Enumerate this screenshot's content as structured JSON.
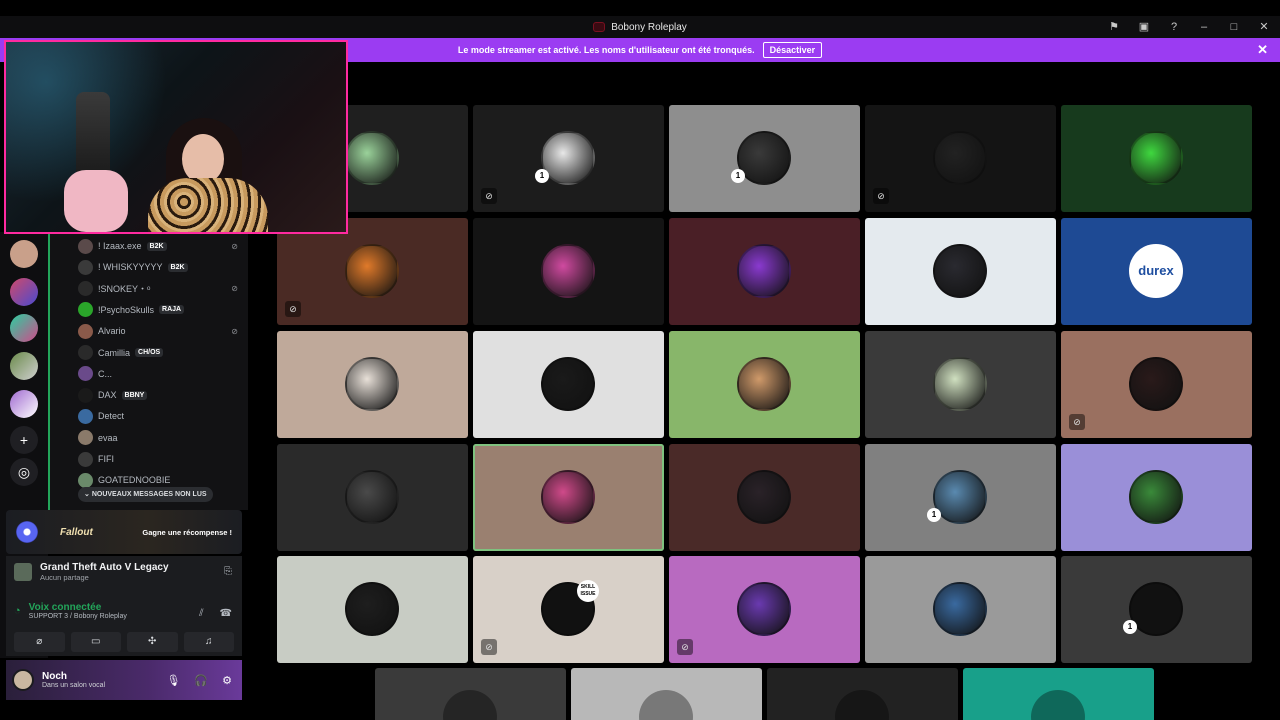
{
  "titlebar": {
    "title": "Bobony Roleplay",
    "icons": [
      "flag-icon",
      "inbox-icon",
      "help-icon",
      "minimize-icon",
      "maximize-icon",
      "close-icon"
    ]
  },
  "banner": {
    "text": "Le mode streamer est activé. Les noms d'utilisateur ont été tronqués.",
    "button": "Désactiver",
    "close": "✕"
  },
  "members": [
    {
      "name": "! Izaax.exe",
      "tag": "B2K",
      "avatar_color": "#5a4a4a",
      "muted": true
    },
    {
      "name": "! WHISKYYYYY",
      "tag": "B2K",
      "avatar_color": "#3a3a3a",
      "muted": false
    },
    {
      "name": "!SNOKEY・ᵒ",
      "tag": "",
      "avatar_color": "#2a2a2a",
      "muted": true
    },
    {
      "name": "!PsychoSkulls",
      "tag": "RAJA",
      "avatar_color": "#2aa52a",
      "muted": false
    },
    {
      "name": "Alvario",
      "tag": "",
      "avatar_color": "#8a5a4a",
      "muted": true
    },
    {
      "name": "Camillia",
      "tag": "CH/OS",
      "avatar_color": "#2a2a2a",
      "muted": false
    },
    {
      "name": "C...",
      "tag": "",
      "avatar_color": "#6a4a8a",
      "muted": false
    },
    {
      "name": "DAX",
      "tag": "BBNY",
      "avatar_color": "#1a1a1a",
      "muted": false
    },
    {
      "name": "Detect",
      "tag": "",
      "avatar_color": "#3a6aa0",
      "muted": false
    },
    {
      "name": "evaa",
      "tag": "",
      "avatar_color": "#8a7a6a",
      "muted": false
    },
    {
      "name": "FIFI",
      "tag": "",
      "avatar_color": "#3a3a3a",
      "muted": false
    },
    {
      "name": "GOATEDNOOBIE",
      "tag": "",
      "avatar_color": "#6a8a6a",
      "muted": false
    }
  ],
  "unread_pill": "NOUVEAUX MESSAGES NON LUS",
  "promo": {
    "brand": "Fallout",
    "cta": "Gagne une récompense !"
  },
  "activity": {
    "game": "Grand Theft Auto V Legacy",
    "sharing": "Aucun partage"
  },
  "voice": {
    "status": "Voix connectée",
    "channel": "SUPPORT 3 / Bobony Roleplay"
  },
  "user": {
    "name": "Noch",
    "status": "Dans un salon vocal"
  },
  "tiles": [
    {
      "bg": "#1f1f1f",
      "avatar": "#9ad29a",
      "muted": false,
      "badge": false
    },
    {
      "bg": "#1c1c1c",
      "avatar": "#e8e8e8",
      "muted": true,
      "badge": true
    },
    {
      "bg": "#8e8e8e",
      "avatar": "#3a3a3a",
      "muted": false,
      "badge": true
    },
    {
      "bg": "#141414",
      "avatar": "#222222",
      "muted": true,
      "badge": false
    },
    {
      "bg": "#173a1d",
      "avatar": "#3fd83f",
      "muted": false,
      "badge": false
    },
    {
      "bg": "#4a2a24",
      "avatar": "#e07a2a",
      "muted": true,
      "badge": false
    },
    {
      "bg": "#141414",
      "avatar": "#d04aa0",
      "muted": false,
      "badge": false
    },
    {
      "bg": "#4a1f26",
      "avatar": "#8a3ad0",
      "muted": false,
      "badge": false
    },
    {
      "bg": "#e4eaee",
      "avatar": "#2a2a30",
      "muted": false,
      "badge": false
    },
    {
      "bg": "#1e4a94",
      "avatar": "#ffffff",
      "muted": false,
      "badge": false,
      "durex": "durex"
    },
    {
      "bg": "#bfa99a",
      "avatar": "#e8e0d8",
      "muted": false,
      "badge": false
    },
    {
      "bg": "#e0e0e0",
      "avatar": "#1a1a1a",
      "muted": false,
      "badge": false
    },
    {
      "bg": "#88b66a",
      "avatar": "#d09a6a",
      "muted": false,
      "badge": false
    },
    {
      "bg": "#3a3a3a",
      "avatar": "#d0e0c0",
      "muted": false,
      "badge": false
    },
    {
      "bg": "#9a7060",
      "avatar": "#2a1a1a",
      "muted": true,
      "badge": false
    },
    {
      "bg": "#2a2a2a",
      "avatar": "#4a4a4a",
      "muted": false,
      "badge": false
    },
    {
      "bg": "#9a8070",
      "avatar": "#d04a8a",
      "muted": false,
      "badge": false,
      "speaking": true
    },
    {
      "bg": "#4a2a28",
      "avatar": "#2a2228",
      "muted": false,
      "badge": false
    },
    {
      "bg": "#808080",
      "avatar": "#5a8ab0",
      "muted": false,
      "badge": true
    },
    {
      "bg": "#9a8fd8",
      "avatar": "#3a8a3a",
      "muted": false,
      "badge": false
    },
    {
      "bg": "#c8ccc4",
      "avatar": "#1e1e1e",
      "muted": false,
      "badge": false
    },
    {
      "bg": "#d8d0c8",
      "avatar": "#111111",
      "muted": true,
      "badge": false,
      "skill": "SKILL ISSUE"
    },
    {
      "bg": "#b86ac0",
      "avatar": "#6a3ab0",
      "muted": true,
      "badge": false
    },
    {
      "bg": "#9a9a9a",
      "avatar": "#3a6aa0",
      "muted": false,
      "badge": false
    },
    {
      "bg": "#3a3a3a",
      "avatar": "#111111",
      "muted": false,
      "badge": true
    }
  ],
  "partial_tiles": [
    {
      "bg": "#3a3a3a"
    },
    {
      "bg": "#b8b8b8"
    },
    {
      "bg": "#222222"
    },
    {
      "bg": "#18a08a"
    }
  ],
  "colors": {
    "banner": "#9b3cf2",
    "webcam_border": "#ff2aa0",
    "voice_green": "#23a55a"
  }
}
